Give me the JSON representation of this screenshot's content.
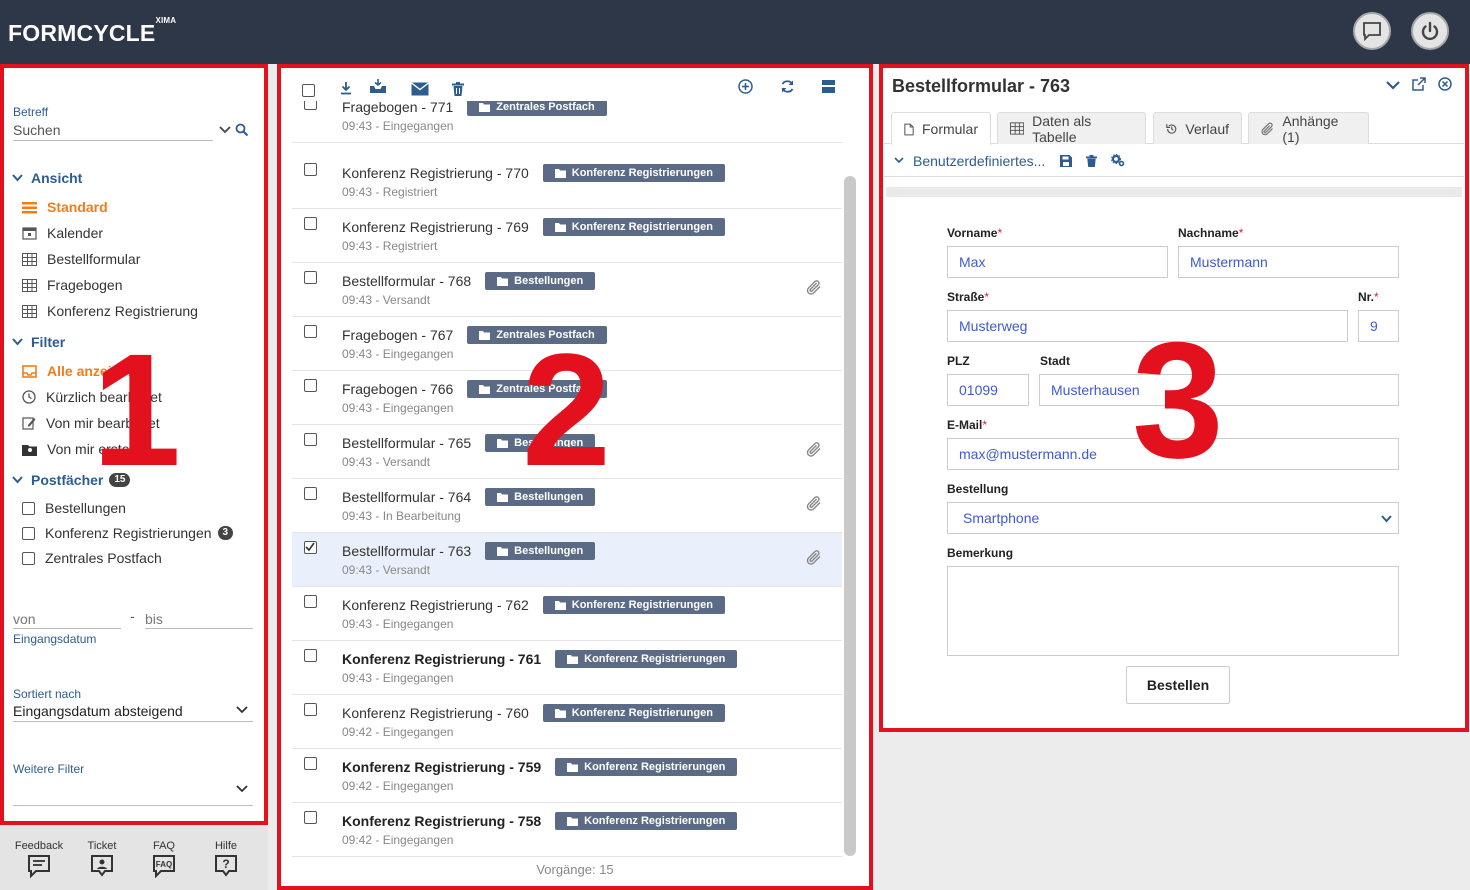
{
  "header": {
    "brand": "FORMCYCLE",
    "brand_sup": "XIMA"
  },
  "left": {
    "betreff_label": "Betreff",
    "search_placeholder": "Suchen",
    "ansicht": {
      "title": "Ansicht",
      "items": [
        "Standard",
        "Kalender",
        "Bestellformular",
        "Fragebogen",
        "Konferenz Registrierung"
      ]
    },
    "filter": {
      "title": "Filter",
      "items": [
        "Alle anzeigen",
        "Kürzlich bearbeitet",
        "Von mir bearbeitet",
        "Von mir erstellt"
      ]
    },
    "postfaecher": {
      "title": "Postfächer",
      "badge": "15",
      "items": [
        "Bestellungen",
        "Konferenz Registrierungen",
        "Zentrales Postfach"
      ],
      "konferenz_badge": "3"
    },
    "date_from": "von",
    "date_sep": "-",
    "date_to": "bis",
    "date_label": "Eingangsdatum",
    "sort_label": "Sortiert nach",
    "sort_value": "Eingangsdatum absteigend",
    "more_filter_label": "Weitere Filter"
  },
  "bottom": {
    "items": [
      "Feedback",
      "Ticket",
      "FAQ",
      "Hilfe"
    ]
  },
  "list": {
    "rows": [
      {
        "title": "Fragebogen - 771",
        "sub": "09:43 - Eingegangen",
        "tag": "Zentrales Postfach"
      },
      {
        "title": "Konferenz Registrierung - 770",
        "sub": "09:43 - Registriert",
        "tag": "Konferenz Registrierungen"
      },
      {
        "title": "Konferenz Registrierung - 769",
        "sub": "09:43 - Registriert",
        "tag": "Konferenz Registrierungen"
      },
      {
        "title": "Bestellformular - 768",
        "sub": "09:43 - Versandt",
        "tag": "Bestellungen"
      },
      {
        "title": "Fragebogen - 767",
        "sub": "09:43 - Eingegangen",
        "tag": "Zentrales Postfach"
      },
      {
        "title": "Fragebogen - 766",
        "sub": "09:43 - Eingegangen",
        "tag": "Zentrales Postfach"
      },
      {
        "title": "Bestellformular - 765",
        "sub": "09:43 - Versandt",
        "tag": "Bestellungen"
      },
      {
        "title": "Bestellformular - 764",
        "sub": "09:43 - In Bearbeitung",
        "tag": "Bestellungen"
      },
      {
        "title": "Bestellformular - 763",
        "sub": "09:43 - Versandt",
        "tag": "Bestellungen"
      },
      {
        "title": "Konferenz Registrierung - 762",
        "sub": "09:43 - Eingegangen",
        "tag": "Konferenz Registrierungen"
      },
      {
        "title": "Konferenz Registrierung - 761",
        "sub": "09:43 - Eingegangen",
        "tag": "Konferenz Registrierungen"
      },
      {
        "title": "Konferenz Registrierung - 760",
        "sub": "09:42 - Eingegangen",
        "tag": "Konferenz Registrierungen"
      },
      {
        "title": "Konferenz Registrierung - 759",
        "sub": "09:42 - Eingegangen",
        "tag": "Konferenz Registrierungen"
      },
      {
        "title": "Konferenz Registrierung - 758",
        "sub": "09:42 - Eingegangen",
        "tag": "Konferenz Registrierungen"
      }
    ],
    "count": "Vorgänge: 15"
  },
  "detail": {
    "title": "Bestellformular - 763",
    "tabs": [
      "Formular",
      "Daten als Tabelle",
      "Verlauf",
      "Anhänge (1)"
    ],
    "view_label": "Benutzerdefiniertes...",
    "form": {
      "vorname_label": "Vorname",
      "vorname": "Max",
      "nachname_label": "Nachname",
      "nachname": "Mustermann",
      "strasse_label": "Straße",
      "strasse": "Musterweg",
      "nr_label": "Nr.",
      "nr": "9",
      "plz_label": "PLZ",
      "plz": "01099",
      "stadt_label": "Stadt",
      "stadt": "Musterhausen",
      "email_label": "E-Mail",
      "email": "max@mustermann.de",
      "bestellung_label": "Bestellung",
      "bestellung": "Smartphone",
      "bemerkung_label": "Bemerkung",
      "bemerkung": "",
      "required_mark": "*",
      "submit": "Bestellen"
    }
  },
  "annotations": [
    "1",
    "2",
    "3"
  ],
  "colors": {
    "topbar": "#2d3748",
    "accent_orange": "#f07d1a",
    "link_blue": "#2d5d90",
    "tag": "#5b6b85",
    "annotation_red": "#e3101e"
  }
}
